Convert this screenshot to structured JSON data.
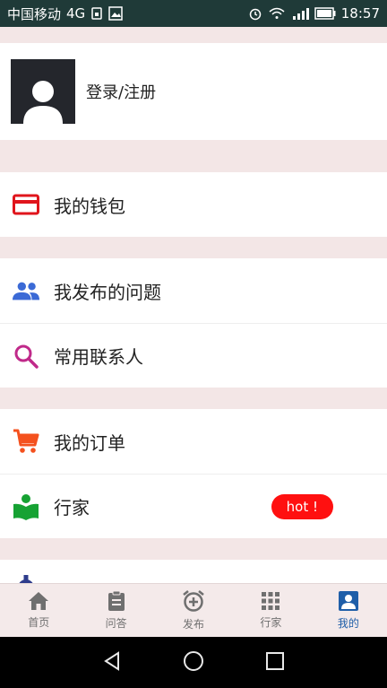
{
  "status_bar": {
    "carrier": "中国移动",
    "network": "4G",
    "time": "18:57"
  },
  "profile": {
    "login_label": "登录/注册"
  },
  "menu": {
    "wallet": "我的钱包",
    "my_questions": "我发布的问题",
    "contacts": "常用联系人",
    "orders": "我的订单",
    "experts": "行家",
    "hot_badge": "hot !"
  },
  "bottom_nav": {
    "home": "首页",
    "qa": "问答",
    "publish": "发布",
    "experts": "行家",
    "mine": "我的"
  },
  "colors": {
    "accent_blue": "#1f5ea8",
    "wallet_red": "#e0151c",
    "cart_orange": "#f4511e",
    "search_purple": "#c02a8a",
    "book_green": "#16a233",
    "people_blue": "#3b6ad6"
  }
}
